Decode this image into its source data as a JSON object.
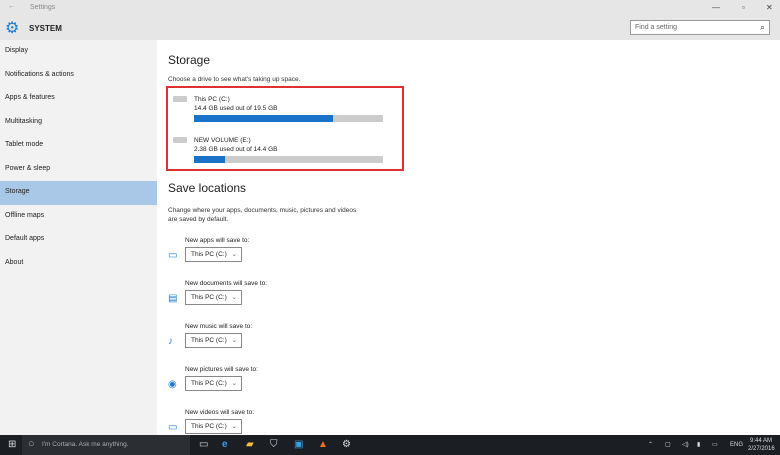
{
  "window": {
    "title": "Settings",
    "back_icon": "arrow-left-icon"
  },
  "header": {
    "section": "SYSTEM",
    "search_placeholder": "Find a setting"
  },
  "sidebar": {
    "items": [
      {
        "label": "Display"
      },
      {
        "label": "Notifications & actions"
      },
      {
        "label": "Apps & features"
      },
      {
        "label": "Multitasking"
      },
      {
        "label": "Tablet mode"
      },
      {
        "label": "Power & sleep"
      },
      {
        "label": "Storage",
        "active": true
      },
      {
        "label": "Offline maps"
      },
      {
        "label": "Default apps"
      },
      {
        "label": "About"
      }
    ]
  },
  "storage": {
    "title": "Storage",
    "subtitle": "Choose a drive to see what's taking up space.",
    "drives": [
      {
        "name": "This PC (C:)",
        "usage": "14.4 GB used out of 19.5 GB",
        "used_fraction": 0.738
      },
      {
        "name": "NEW VOLUME (E:)",
        "usage": "2.38 GB used out of 14.4 GB",
        "used_fraction": 0.165
      }
    ]
  },
  "save_locations": {
    "title": "Save locations",
    "description_1": "Change where your apps, documents, music, pictures and videos",
    "description_2": "are saved by default.",
    "items": [
      {
        "label": "New apps will save to:",
        "value": "This PC (C:)",
        "icon": "monitor-icon"
      },
      {
        "label": "New documents will save to:",
        "value": "This PC (C:)",
        "icon": "documents-icon"
      },
      {
        "label": "New music will save to:",
        "value": "This PC (C:)",
        "icon": "music-note-icon"
      },
      {
        "label": "New pictures will save to:",
        "value": "This PC (C:)",
        "icon": "camera-icon"
      },
      {
        "label": "New videos will save to:",
        "value": "This PC (C:)",
        "icon": "video-icon"
      }
    ]
  },
  "taskbar": {
    "cortana": "I'm Cortana. Ask me anything.",
    "lang": "ENG",
    "time": "9:44 AM",
    "date": "2/27/2016"
  },
  "colors": {
    "accent": "#1a73c9",
    "highlight": "#e03030",
    "selected": "#a9c8e8"
  }
}
